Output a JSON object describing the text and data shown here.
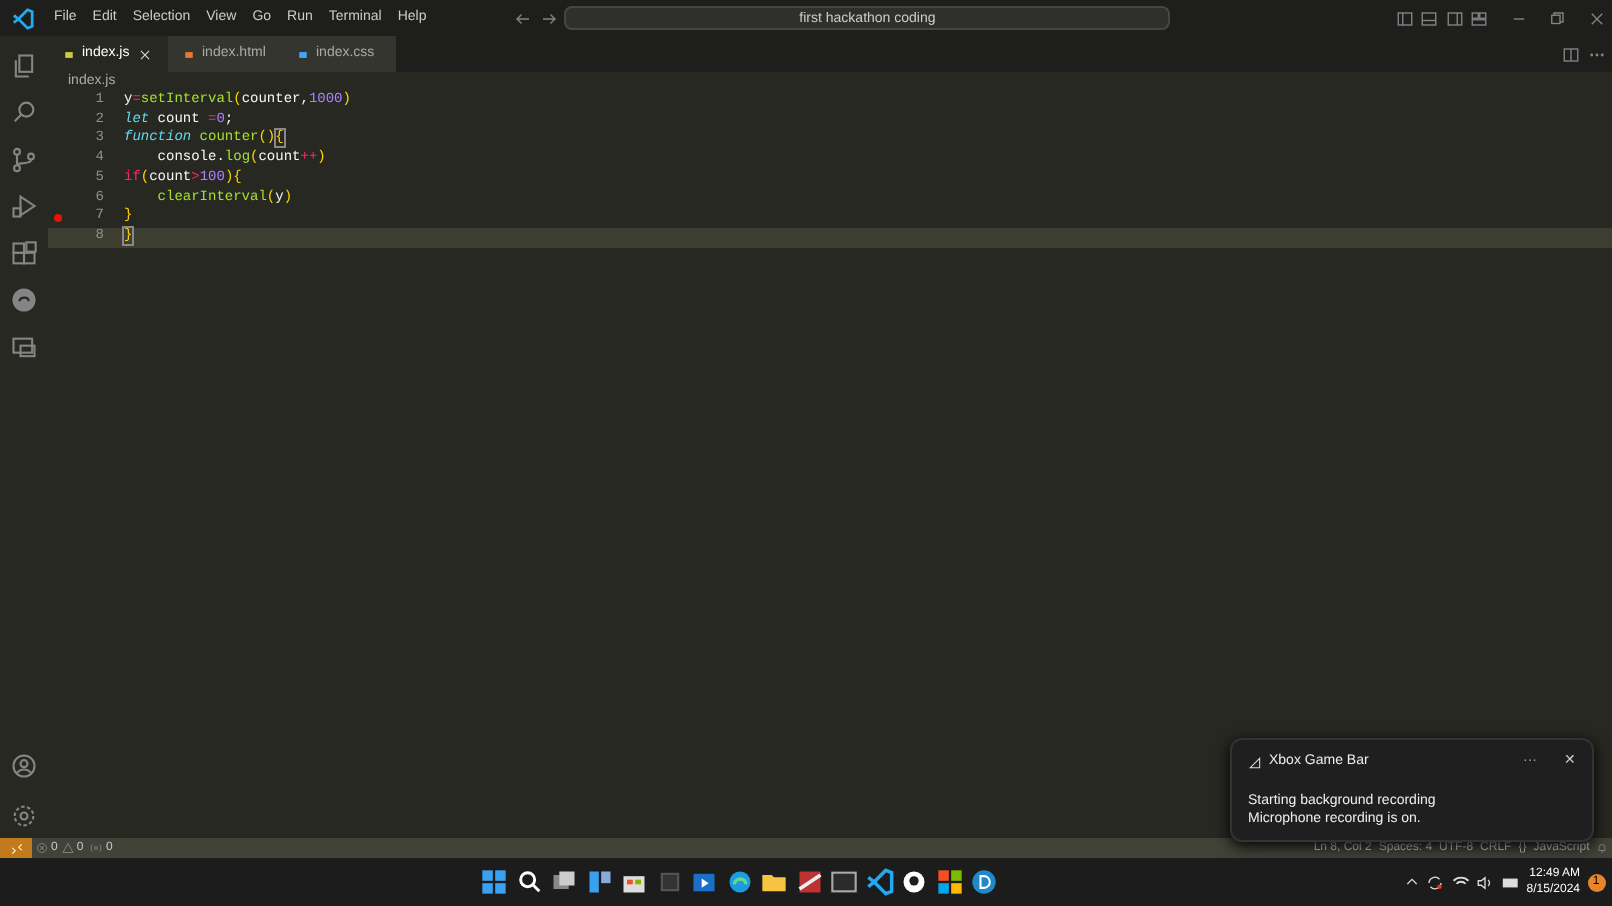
{
  "menu": [
    "File",
    "Edit",
    "Selection",
    "View",
    "Go",
    "Run",
    "Terminal",
    "Help"
  ],
  "search": {
    "value": "first hackathon coding"
  },
  "tabs": [
    {
      "label": "index.js",
      "kind": "js",
      "selected": true
    },
    {
      "label": "index.html",
      "kind": "html",
      "selected": false
    },
    {
      "label": "index.css",
      "kind": "css",
      "selected": false
    }
  ],
  "breadcrumb": "index.js",
  "code": [
    {
      "number": "1",
      "breakpoint": false,
      "current": false,
      "tokens": [
        {
          "text": "y",
          "kind": "plain"
        },
        {
          "text": "=",
          "kind": "operator"
        },
        {
          "text": "setInterval",
          "kind": "function"
        },
        {
          "text": "(",
          "kind": "bracket"
        },
        {
          "text": "counter",
          "kind": "plain"
        },
        {
          "text": ",",
          "kind": "plain"
        },
        {
          "text": "1000",
          "kind": "number"
        },
        {
          "text": ")",
          "kind": "bracket"
        }
      ]
    },
    {
      "number": "2",
      "breakpoint": false,
      "current": false,
      "tokens": [
        {
          "text": "let",
          "kind": "keyword"
        },
        {
          "text": " count ",
          "kind": "plain"
        },
        {
          "text": "=",
          "kind": "operator"
        },
        {
          "text": "0",
          "kind": "number"
        },
        {
          "text": ";",
          "kind": "plain"
        }
      ]
    },
    {
      "number": "3",
      "breakpoint": false,
      "current": false,
      "tokens": [
        {
          "text": "function",
          "kind": "keyword"
        },
        {
          "text": " counter",
          "kind": "function"
        },
        {
          "text": "()",
          "kind": "bracket"
        },
        {
          "text": "{",
          "kind": "match"
        }
      ]
    },
    {
      "number": "4",
      "breakpoint": false,
      "current": false,
      "tokens": [
        {
          "text": "    console",
          "kind": "plain"
        },
        {
          "text": ".",
          "kind": "plain"
        },
        {
          "text": "log",
          "kind": "function"
        },
        {
          "text": "(",
          "kind": "bracket"
        },
        {
          "text": "count",
          "kind": "plain"
        },
        {
          "text": "++",
          "kind": "operator"
        },
        {
          "text": ")",
          "kind": "bracket"
        }
      ]
    },
    {
      "number": "5",
      "breakpoint": false,
      "current": false,
      "tokens": [
        {
          "text": "if",
          "kind": "keyword2"
        },
        {
          "text": "(",
          "kind": "bracket"
        },
        {
          "text": "count",
          "kind": "plain"
        },
        {
          "text": ">",
          "kind": "operator"
        },
        {
          "text": "100",
          "kind": "number"
        },
        {
          "text": ")",
          "kind": "bracket"
        },
        {
          "text": "{",
          "kind": "bracket"
        }
      ]
    },
    {
      "number": "6",
      "breakpoint": false,
      "current": false,
      "tokens": [
        {
          "text": "    clearInterval",
          "kind": "function"
        },
        {
          "text": "(",
          "kind": "bracket"
        },
        {
          "text": "y",
          "kind": "plain"
        },
        {
          "text": ")",
          "kind": "bracket"
        }
      ]
    },
    {
      "number": "7",
      "breakpoint": true,
      "current": false,
      "tokens": [
        {
          "text": "}",
          "kind": "bracket"
        }
      ]
    },
    {
      "number": "8",
      "breakpoint": false,
      "current": true,
      "tokens": [
        {
          "text": "}",
          "kind": "match"
        }
      ]
    }
  ],
  "notification": {
    "title": "Xbox Game Bar",
    "more": "···",
    "close": "✕",
    "lines": [
      "Starting background recording",
      "Microphone recording is on."
    ]
  },
  "status_bar": {
    "errors": "0",
    "warnings": "0",
    "ports": "0",
    "right": [
      "Ln 8, Col 2",
      "Spaces: 4",
      "UTF-8",
      "CRLF",
      "{}",
      "JavaScript"
    ]
  },
  "taskbar": {
    "time": "12:49 AM",
    "date": "8/15/2024",
    "badge": "1"
  }
}
